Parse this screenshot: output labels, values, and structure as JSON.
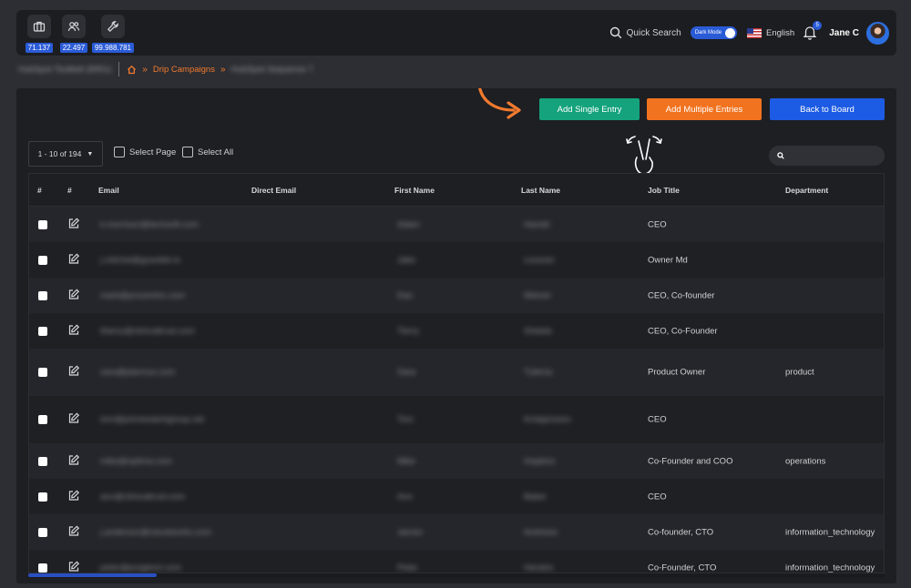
{
  "topbar": {
    "stats": [
      {
        "icon": "briefcase-icon",
        "value": "71.137"
      },
      {
        "icon": "users-icon",
        "value": "22.497"
      },
      {
        "icon": "wrench-icon",
        "value": "99.988.781"
      }
    ],
    "quick_search": "Quick Search",
    "dark_mode_label": "Dark Mode",
    "language": "English",
    "notification_count": "5",
    "user_name": "Jane C"
  },
  "breadcrumb": {
    "first": "HubSpot Toolbelt (8451)",
    "home_icon": "home-icon",
    "current": "Drip Campaigns",
    "last": "HubSpot Sequence 7"
  },
  "toolbar": {
    "add_single": "Add Single Entry",
    "add_multiple": "Add Multiple Entries",
    "back": "Back to Board"
  },
  "filters": {
    "pager": "1 - 10 of 194",
    "select_page": "Select Page",
    "select_all": "Select All",
    "search_placeholder": ""
  },
  "table": {
    "headers": [
      "#",
      "#",
      "Email",
      "Direct Email",
      "First Name",
      "Last Name",
      "Job Title",
      "Department"
    ],
    "rows": [
      {
        "email": "k.morrison@techsoft.com",
        "first": "Adam",
        "last": "Harold",
        "title": "CEO",
        "dept": ""
      },
      {
        "email": "j.mitchel@gravitek.io",
        "first": "Jake",
        "last": "Lessner",
        "title": "Owner Md",
        "dept": ""
      },
      {
        "email": "mark@procentric.com",
        "first": "Dan",
        "last": "Weiner",
        "title": "CEO, Co-founder",
        "dept": ""
      },
      {
        "email": "thierry@clinicaltrust.com",
        "first": "Tierry",
        "last": "Shields",
        "title": "CEO, Co-Founder",
        "dept": ""
      },
      {
        "email": "sara@plannus.com",
        "first": "Sara",
        "last": "Tulema",
        "title": "Product Owner",
        "dept": "product"
      },
      {
        "email": "tom@primewatchgroup.net",
        "first": "Tom",
        "last": "Kristjansson",
        "title": "CEO",
        "dept": ""
      },
      {
        "email": "mike@optima.com",
        "first": "Mike",
        "last": "Hopkins",
        "title": "Co-Founder and COO",
        "dept": "operations"
      },
      {
        "email": "ann@clinicaltrust.com",
        "first": "Ann",
        "last": "Baker",
        "title": "CEO",
        "dept": ""
      },
      {
        "email": "j.anderson@cloudworks.com",
        "first": "James",
        "last": "Andrews",
        "title": "Co-founder, CTO",
        "dept": "information_technology"
      },
      {
        "email": "peter@progtech.com",
        "first": "Peter",
        "last": "Hendrix",
        "title": "Co-Founder, CTO",
        "dept": "information_technology"
      }
    ]
  },
  "colors": {
    "green": "#14a37c",
    "orange": "#f1731f",
    "blue": "#1c5be3",
    "accent": "#f27a2e"
  }
}
